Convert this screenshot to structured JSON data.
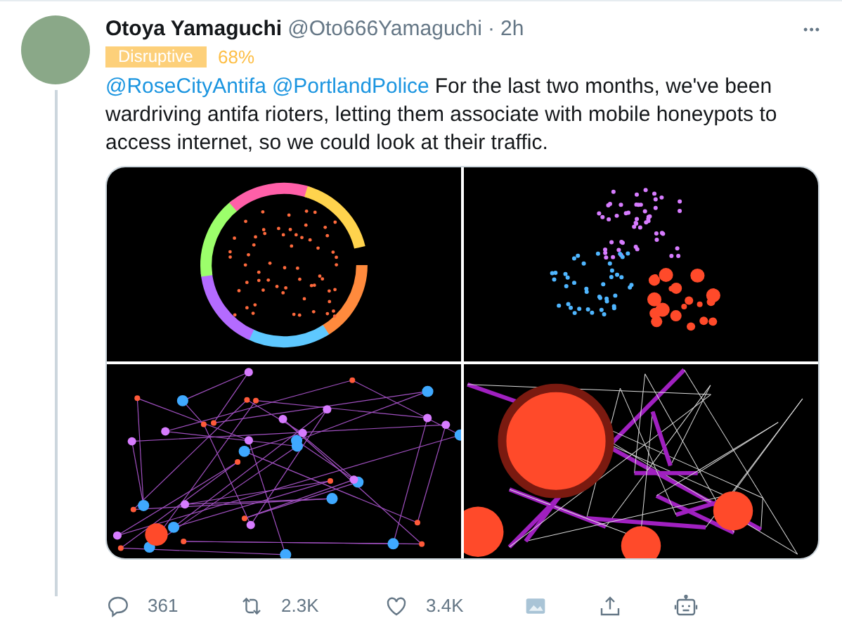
{
  "tweet": {
    "author": {
      "name": "Otoya Yamaguchi",
      "handle": "@Oto666Yamaguchi",
      "separator": "·",
      "time": "2h"
    },
    "more": "•••",
    "label": {
      "text": "Disruptive",
      "score": "68%"
    },
    "text": {
      "mentions": [
        "@RoseCityAntifa",
        "@PortlandPolice"
      ],
      "body": "For the last two months, we've been wardriving antifa rioters, letting them associate with mobile honeypots to access internet, so we could look at their traffic."
    },
    "images": [
      {
        "kind": "ring"
      },
      {
        "kind": "cluster"
      },
      {
        "kind": "mesh"
      },
      {
        "kind": "bubbles"
      }
    ],
    "actions": [
      {
        "kind": "reply",
        "count": "361"
      },
      {
        "kind": "retweet",
        "count": "2.3K"
      },
      {
        "kind": "like",
        "count": "3.4K"
      },
      {
        "kind": "image"
      },
      {
        "kind": "share"
      },
      {
        "kind": "bot"
      }
    ]
  }
}
